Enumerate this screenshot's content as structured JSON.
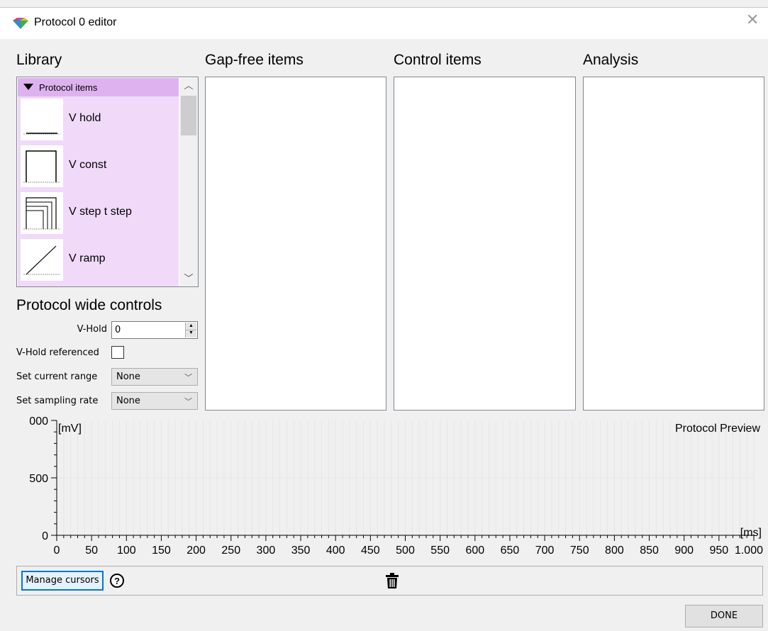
{
  "window": {
    "title": "Protocol 0 editor"
  },
  "sections": {
    "library": "Library",
    "gap_free": "Gap-free items",
    "control": "Control items",
    "analysis": "Analysis",
    "protocol_wide": "Protocol wide controls"
  },
  "library": {
    "group_label": "Protocol items",
    "items": [
      {
        "label": "V hold",
        "icon": "v-hold-icon"
      },
      {
        "label": "V const",
        "icon": "v-const-icon"
      },
      {
        "label": "V step t step",
        "icon": "v-step-t-step-icon"
      },
      {
        "label": "V ramp",
        "icon": "v-ramp-icon"
      }
    ]
  },
  "controls": {
    "v_hold_label": "V-Hold",
    "v_hold_value": "0",
    "v_hold_ref_label": "V-Hold referenced",
    "v_hold_ref_checked": false,
    "current_range_label": "Set current range",
    "current_range_value": "None",
    "sampling_rate_label": "Set sampling rate",
    "sampling_rate_value": "None"
  },
  "preview": {
    "title": "Protocol Preview",
    "y_unit": "[mV]",
    "x_unit": "[ms]",
    "y_ticks": [
      "0",
      "500",
      "000"
    ],
    "x_ticks": [
      "0",
      "50",
      "100",
      "150",
      "200",
      "250",
      "300",
      "350",
      "400",
      "450",
      "500",
      "550",
      "600",
      "650",
      "700",
      "750",
      "800",
      "850",
      "900",
      "950",
      "1.000"
    ]
  },
  "chart_data": {
    "type": "line",
    "title": "Protocol Preview",
    "xlabel": "[ms]",
    "ylabel": "[mV]",
    "xlim": [
      0,
      1000
    ],
    "ylim": [
      0,
      1000
    ],
    "x_tick_labels": [
      "0",
      "50",
      "100",
      "150",
      "200",
      "250",
      "300",
      "350",
      "400",
      "450",
      "500",
      "550",
      "600",
      "650",
      "700",
      "750",
      "800",
      "850",
      "900",
      "950",
      "1.000"
    ],
    "y_tick_labels": [
      "0",
      "500",
      "000"
    ],
    "grid": true,
    "series": []
  },
  "bottom": {
    "manage_cursors": "Manage cursors",
    "help": "?",
    "trash_icon": "trash-icon",
    "done": "DONE"
  }
}
